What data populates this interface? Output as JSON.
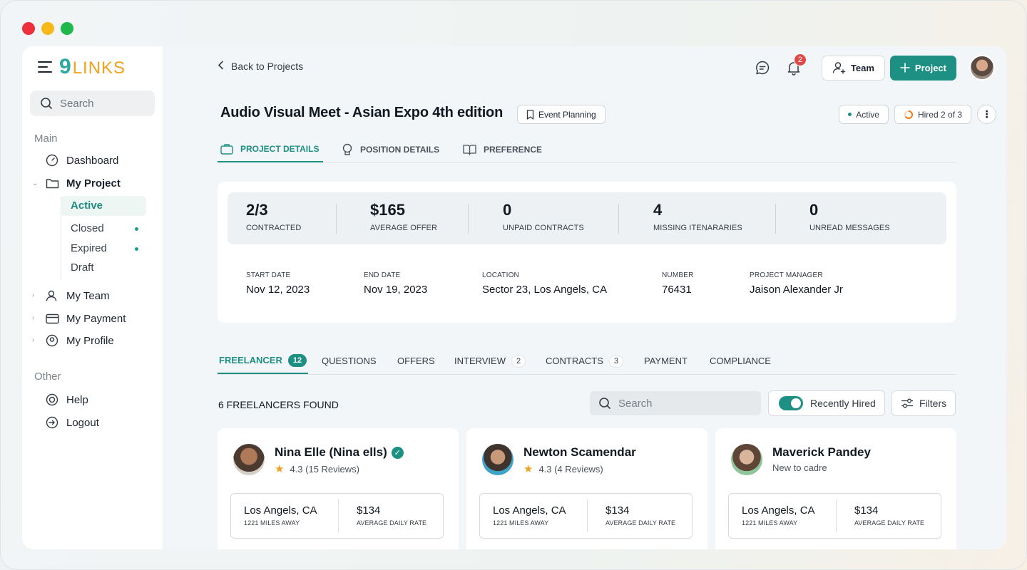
{
  "logo": {
    "mark": "9",
    "word": "LINKS"
  },
  "sidebar": {
    "search_placeholder": "Search",
    "section_main": "Main",
    "section_other": "Other",
    "items": {
      "dashboard": "Dashboard",
      "my_project": "My Project",
      "my_team": "My Team",
      "my_payment": "My Payment",
      "my_profile": "My Profile",
      "help": "Help",
      "logout": "Logout"
    },
    "project_sub": [
      "Active",
      "Closed",
      "Expired",
      "Draft"
    ]
  },
  "header": {
    "back": "Back to Projects",
    "notification_count": "2",
    "team_button": "Team",
    "project_button": "Project"
  },
  "project": {
    "title": "Audio Visual Meet - Asian Expo 4th edition",
    "category": "Event Planning",
    "status": "Active",
    "hired": "Hired 2 of 3"
  },
  "tabs_top": [
    "PROJECT DETAILS",
    "POSITION DETAILS",
    "PREFERENCE"
  ],
  "stats": [
    {
      "num": "2/3",
      "label": "CONTRACTED"
    },
    {
      "num": "$165",
      "label": "AVERAGE OFFER"
    },
    {
      "num": "0",
      "label": "UNPAID CONTRACTS"
    },
    {
      "num": "4",
      "label": "MISSING ITENARARIES"
    },
    {
      "num": "0",
      "label": "UNREAD MESSAGES"
    }
  ],
  "meta": [
    {
      "key": "START DATE",
      "value": "Nov 12, 2023"
    },
    {
      "key": "END DATE",
      "value": "Nov 19, 2023"
    },
    {
      "key": "LOCATION",
      "value": "Sector 23, Los Angels, CA"
    },
    {
      "key": "NUMBER",
      "value": "76431"
    },
    {
      "key": "PROJECT MANAGER",
      "value": "Jaison Alexander Jr"
    }
  ],
  "tabs_bottom": {
    "freelancer": "FREELANCER",
    "freelancer_count": "12",
    "questions": "QUESTIONS",
    "offers": "OFFERS",
    "interview": "INTERVIEW",
    "interview_count": "2",
    "contracts": "CONTRACTS",
    "contracts_count": "3",
    "payment": "PAYMENT",
    "compliance": "COMPLIANCE"
  },
  "toolbar": {
    "found": "6 FREELANCERS FOUND",
    "search_placeholder": "Search",
    "recently_hired": "Recently Hired",
    "recently_hired_on": true,
    "filters": "Filters"
  },
  "freelancers": [
    {
      "name": "Nina Elle (Nina ells)",
      "sub": "4.3 (15 Reviews)",
      "location": "Los Angels, CA",
      "distance": "1221 MILES AWAY",
      "rate": "$134",
      "rate_label": "AVERAGE DAILY RATE"
    },
    {
      "name": "Newton Scamendar",
      "sub": "4.3 (4 Reviews)",
      "location": "Los Angels, CA",
      "distance": "1221 MILES AWAY",
      "rate": "$134",
      "rate_label": "AVERAGE DAILY RATE"
    },
    {
      "name": "Maverick Pandey",
      "sub": "New to cadre",
      "location": "Los Angels, CA",
      "distance": "1221 MILES AWAY",
      "rate": "$134",
      "rate_label": "AVERAGE DAILY RATE"
    }
  ],
  "colors": {
    "accent": "#1d8f83",
    "logo_nine": "#2ba8a0",
    "logo_links": "#f2a11d",
    "badge": "#e04848"
  }
}
